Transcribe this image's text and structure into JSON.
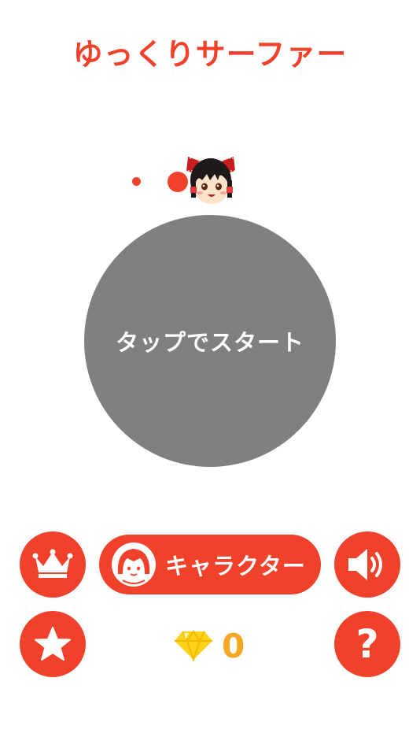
{
  "app": {
    "title": "ゆっくりサーファー"
  },
  "start": {
    "label": "タップでスタート"
  },
  "buttons": {
    "ranking_icon": "crown-icon",
    "character_label": "キャラクター",
    "character_icon": "girl-avatar-icon",
    "sound_icon": "speaker-icon",
    "review_icon": "star-icon",
    "help_glyph": "?"
  },
  "gems": {
    "icon": "diamond-icon",
    "count": "0"
  },
  "colors": {
    "accent": "#f0412a",
    "start_circle": "#808080",
    "gem_count": "#f5a623",
    "gem": "#ffd21a",
    "background": "#ffffff"
  }
}
